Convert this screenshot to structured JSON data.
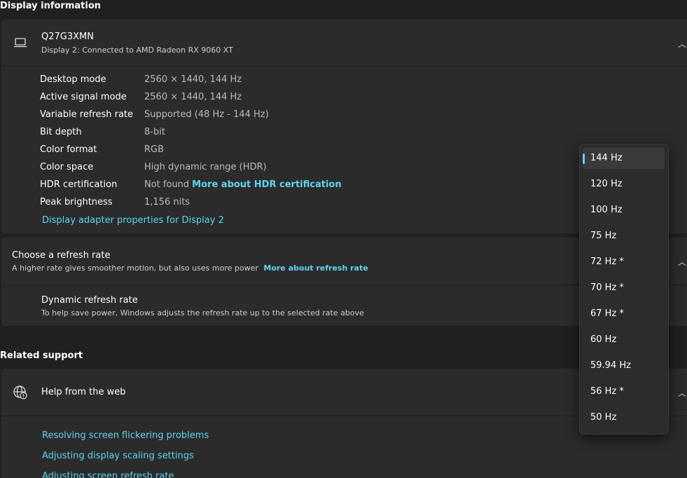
{
  "display_info": {
    "heading": "Display information",
    "monitor_name": "Q27G3XMN",
    "monitor_sub": "Display 2: Connected to AMD Radeon RX 9060 XT",
    "rows": [
      {
        "label": "Desktop mode",
        "value": "2560 × 1440, 144 Hz"
      },
      {
        "label": "Active signal mode",
        "value": "2560 × 1440, 144 Hz"
      },
      {
        "label": "Variable refresh rate",
        "value": "Supported (48 Hz - 144 Hz)"
      },
      {
        "label": "Bit depth",
        "value": "8-bit"
      },
      {
        "label": "Color format",
        "value": "RGB"
      },
      {
        "label": "Color space",
        "value": "High dynamic range (HDR)"
      },
      {
        "label": "HDR certification",
        "value": "Not found",
        "link": "More about HDR certification"
      },
      {
        "label": "Peak brightness",
        "value": "1,156 nits"
      }
    ],
    "adapter_link": "Display adapter properties for Display 2"
  },
  "refresh": {
    "title": "Choose a refresh rate",
    "subtitle": "A higher rate gives smoother motion, but also uses more power",
    "link": "More about refresh rate",
    "dynamic_title": "Dynamic refresh rate",
    "dynamic_sub": "To help save power, Windows adjusts the refresh rate up to the selected rate above"
  },
  "related": {
    "heading": "Related support",
    "help_title": "Help from the web",
    "links": [
      "Resolving screen flickering problems",
      "Adjusting display scaling settings",
      "Adjusting screen refresh rate"
    ]
  },
  "dropdown": {
    "selected_index": 0,
    "accent": "#60cdff",
    "options": [
      "144 Hz",
      "120 Hz",
      "100 Hz",
      "75 Hz",
      "72 Hz *",
      "70 Hz *",
      "67 Hz *",
      "60 Hz",
      "59.94 Hz",
      "56 Hz *",
      "50 Hz"
    ]
  },
  "icons": {
    "monitor": "laptop-icon",
    "globe": "globe-help-icon",
    "chevron": "chevron-up-icon"
  }
}
